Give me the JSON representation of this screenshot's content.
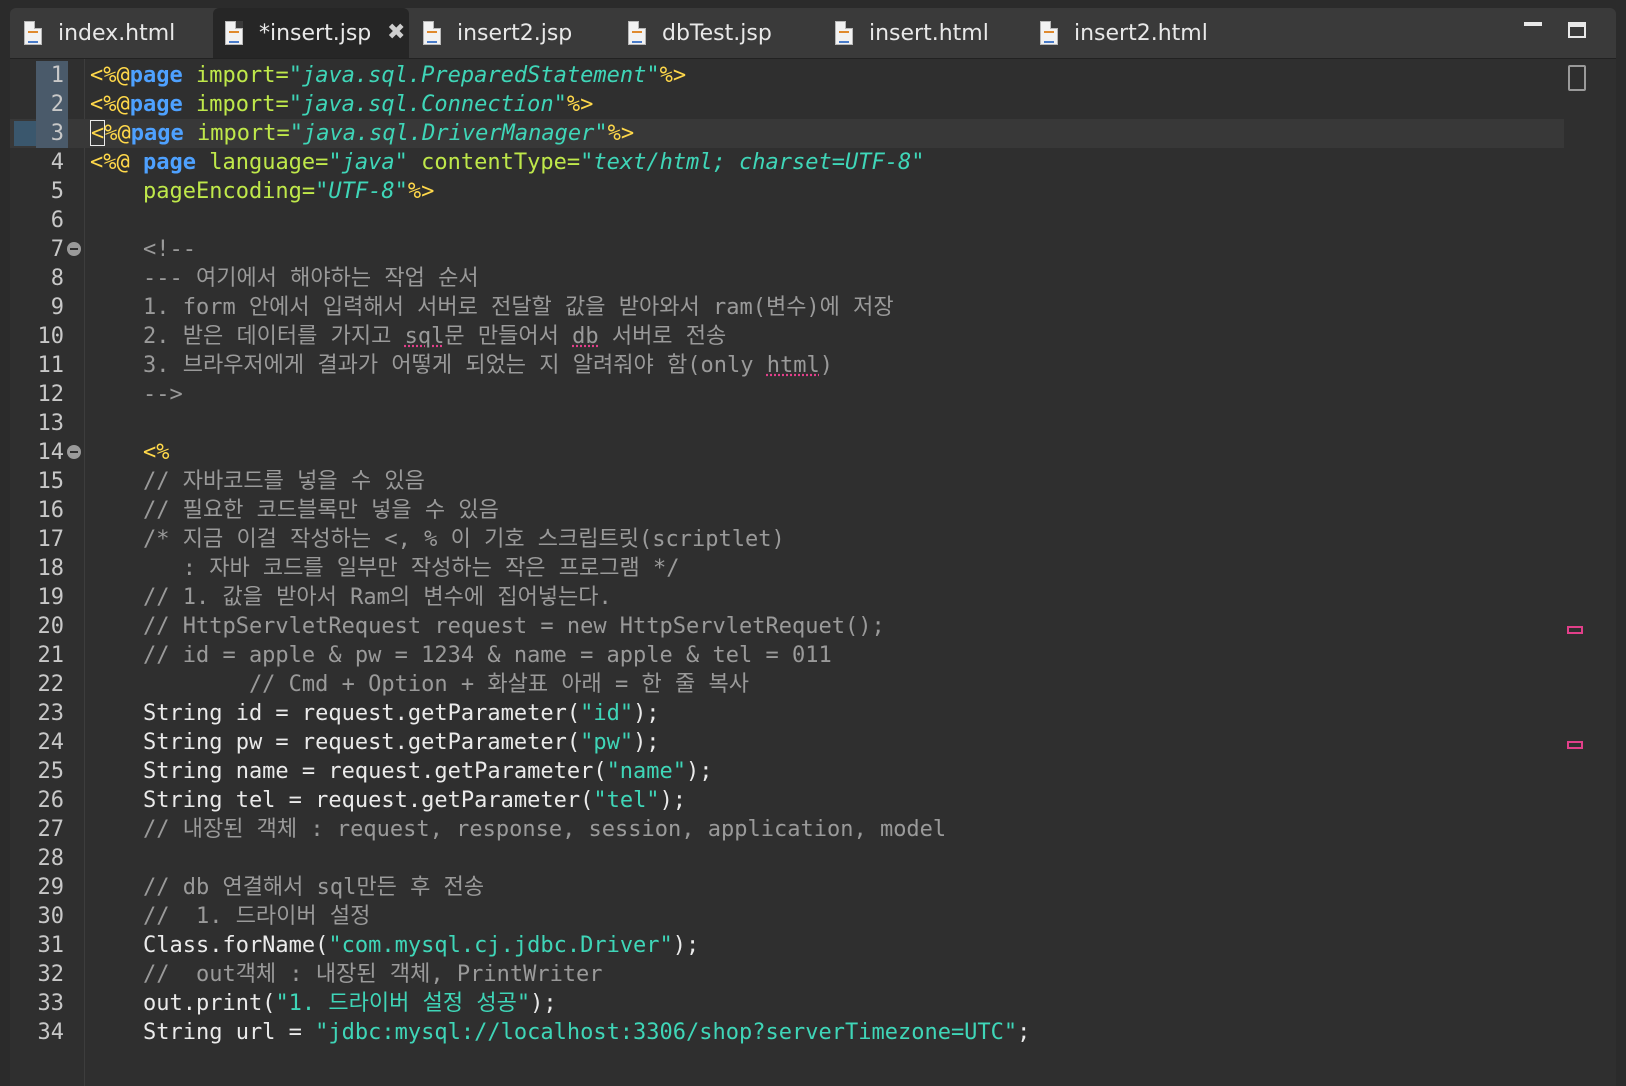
{
  "tabs": [
    {
      "label": "index.html",
      "active": false
    },
    {
      "label": "*insert.jsp",
      "active": true,
      "close_symbol": "✖"
    },
    {
      "label": "insert2.jsp",
      "active": false
    },
    {
      "label": "dbTest.jsp",
      "active": false
    },
    {
      "label": "insert.html",
      "active": false
    },
    {
      "label": "insert2.html",
      "active": false
    }
  ],
  "editor": {
    "current_line": 3,
    "fold_lines": [
      7,
      14
    ],
    "lines": [
      {
        "n": "1"
      },
      {
        "n": "2"
      },
      {
        "n": "3"
      },
      {
        "n": "4"
      },
      {
        "n": "5"
      },
      {
        "n": "6"
      },
      {
        "n": "7"
      },
      {
        "n": "8"
      },
      {
        "n": "9"
      },
      {
        "n": "10"
      },
      {
        "n": "11"
      },
      {
        "n": "12"
      },
      {
        "n": "13"
      },
      {
        "n": "14"
      },
      {
        "n": "15"
      },
      {
        "n": "16"
      },
      {
        "n": "17"
      },
      {
        "n": "18"
      },
      {
        "n": "19"
      },
      {
        "n": "20"
      },
      {
        "n": "21"
      },
      {
        "n": "22"
      },
      {
        "n": "23"
      },
      {
        "n": "24"
      },
      {
        "n": "25"
      },
      {
        "n": "26"
      },
      {
        "n": "27"
      },
      {
        "n": "28"
      },
      {
        "n": "29"
      },
      {
        "n": "30"
      },
      {
        "n": "31"
      },
      {
        "n": "32"
      },
      {
        "n": "33"
      },
      {
        "n": "34"
      }
    ],
    "text": {
      "l1": {
        "a": "<%@",
        "b": "page",
        "c": " import=",
        "d": "\"java.sql.PreparedStatement\"",
        "e": "%>"
      },
      "l2": {
        "a": "<%@",
        "b": "page",
        "c": " import=",
        "d": "\"java.sql.Connection\"",
        "e": "%>"
      },
      "l3": {
        "a": "%@",
        "b": "page",
        "c": " import=",
        "d": "\"java.sql.DriverManager\"",
        "e": "%>"
      },
      "l4": {
        "a": "<%@ ",
        "b": "page",
        "c": " language=",
        "d": "\"java\"",
        "f": " contentType=",
        "g": "\"text/html; charset=UTF-8\""
      },
      "l5": {
        "c": "    pageEncoding=",
        "d": "\"UTF-8\"",
        "e": "%>"
      },
      "l7": "    <!--",
      "l8": "    --- 여기에서 해야하는 작업 순서",
      "l9": "    1. form 안에서 입력해서 서버로 전달할 값을 받아와서 ram(변수)에 저장",
      "l10": {
        "a": "    2. 받은 데이터를 가지고 ",
        "u1": "sql",
        "b": "문 만들어서 ",
        "u2": "db",
        "c": " 서버로 전송"
      },
      "l11": {
        "a": "    3. 브라우저에게 결과가 어떻게 되었는 지 알려줘야 함(only ",
        "u1": "html",
        "b": ")"
      },
      "l12": "    -->",
      "l14": "    <%",
      "l15": "    // 자바코드를 넣을 수 있음",
      "l16": "    // 필요한 코드블록만 넣을 수 있음",
      "l17": "    /* 지금 이걸 작성하는 <, % 이 기호 스크립트릿(scriptlet)",
      "l18": "       : 자바 코드를 일부만 작성하는 작은 프로그램 */",
      "l19": "    // 1. 값을 받아서 Ram의 변수에 집어넣는다.",
      "l20": "    // HttpServletRequest request = new HttpServletRequet();",
      "l21": "    // id = apple & pw = 1234 & name = apple & tel = 011",
      "l22": "            // Cmd + Option + 화살표 아래 = 한 줄 복사",
      "l23": {
        "a": "    String id = request.getParameter(",
        "s": "\"id\"",
        "b": ");"
      },
      "l24": {
        "a": "    String pw = request.getParameter(",
        "s": "\"pw\"",
        "b": ");"
      },
      "l25": {
        "a": "    String name = request.getParameter(",
        "s": "\"name\"",
        "b": ");"
      },
      "l26": {
        "a": "    String tel = request.getParameter(",
        "s": "\"tel\"",
        "b": ");"
      },
      "l27": "    // 내장된 객체 : request, response, session, application, model",
      "l29": "    // db 연결해서 sql만든 후 전송",
      "l30": "    //  1. 드라이버 설정",
      "l31": {
        "a": "    Class.forName(",
        "s": "\"com.mysql.cj.jdbc.Driver\"",
        "b": ");"
      },
      "l32": "    //  out객체 : 내장된 객체, PrintWriter",
      "l33": {
        "a": "    out.print(",
        "s": "\"1. 드라이버 설정 성공\"",
        "b": ");"
      },
      "l34": {
        "a": "    String url = ",
        "s": "\"jdbc:mysql://localhost:3306/shop?serverTimezone=UTC\"",
        "b": ";"
      }
    }
  },
  "colors": {
    "keyword": "#4ea1ff",
    "directive": "#ffd84a",
    "attribute": "#bfe84a",
    "string": "#3fd6b8",
    "comment": "#9a9a9a",
    "spell_error": "#e23f8a"
  }
}
